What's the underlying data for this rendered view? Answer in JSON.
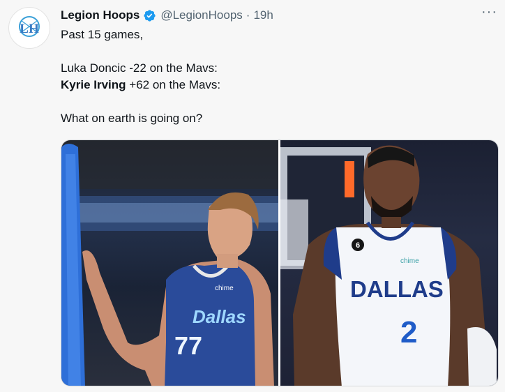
{
  "tweet": {
    "author_name": "Legion Hoops",
    "handle": "@LegionHoops",
    "separator": "·",
    "time": "19h",
    "more_label": "···",
    "avatar_monogram": "LH",
    "lines": {
      "intro": "Past 15 games,",
      "luka": "Luka Doncic -22 on the Mavs:",
      "kyrie_name": "Kyrie Irving",
      "kyrie_rest": " +62 on the Mavs:",
      "question": "What on earth is going on?"
    }
  },
  "media": {
    "left_photo": {
      "jersey_team": "Dallas",
      "jersey_number": "77",
      "sponsor": "chime"
    },
    "right_photo": {
      "jersey_team": "DALLAS",
      "jersey_number": "2",
      "patch_number": "6",
      "sponsor": "chime"
    }
  },
  "colors": {
    "verified": "#1d9bf0",
    "text": "#0f1419",
    "secondary": "#536471"
  }
}
